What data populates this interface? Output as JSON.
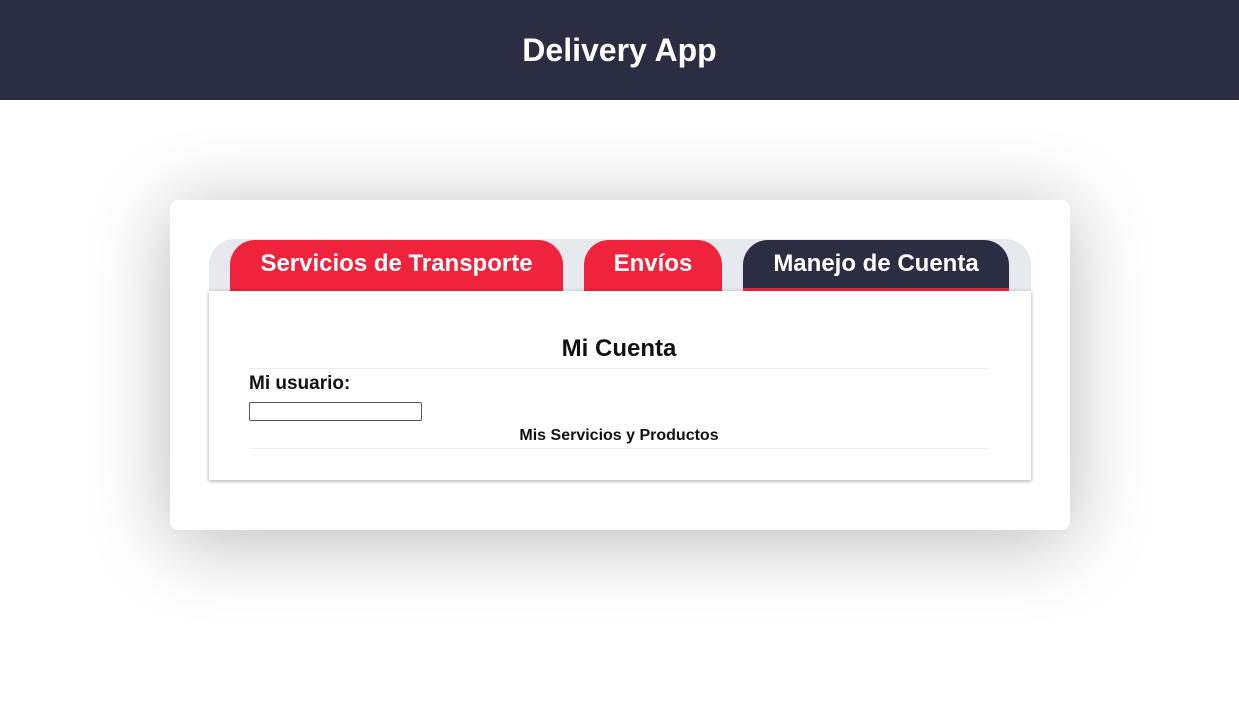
{
  "header": {
    "title": "Delivery App"
  },
  "tabs": [
    {
      "label": "Servicios de Transporte",
      "active": false
    },
    {
      "label": "Envíos",
      "active": false
    },
    {
      "label": "Manejo de Cuenta",
      "active": true
    }
  ],
  "account": {
    "title": "Mi Cuenta",
    "user_label": "Mi usuario:",
    "user_value": "",
    "services_title": "Mis Servicios y Productos"
  },
  "colors": {
    "header_bg": "#2b2d42",
    "tab_red": "#ef233c",
    "tab_active": "#2b2d42",
    "tab_bar_bg": "#e6eaee"
  }
}
